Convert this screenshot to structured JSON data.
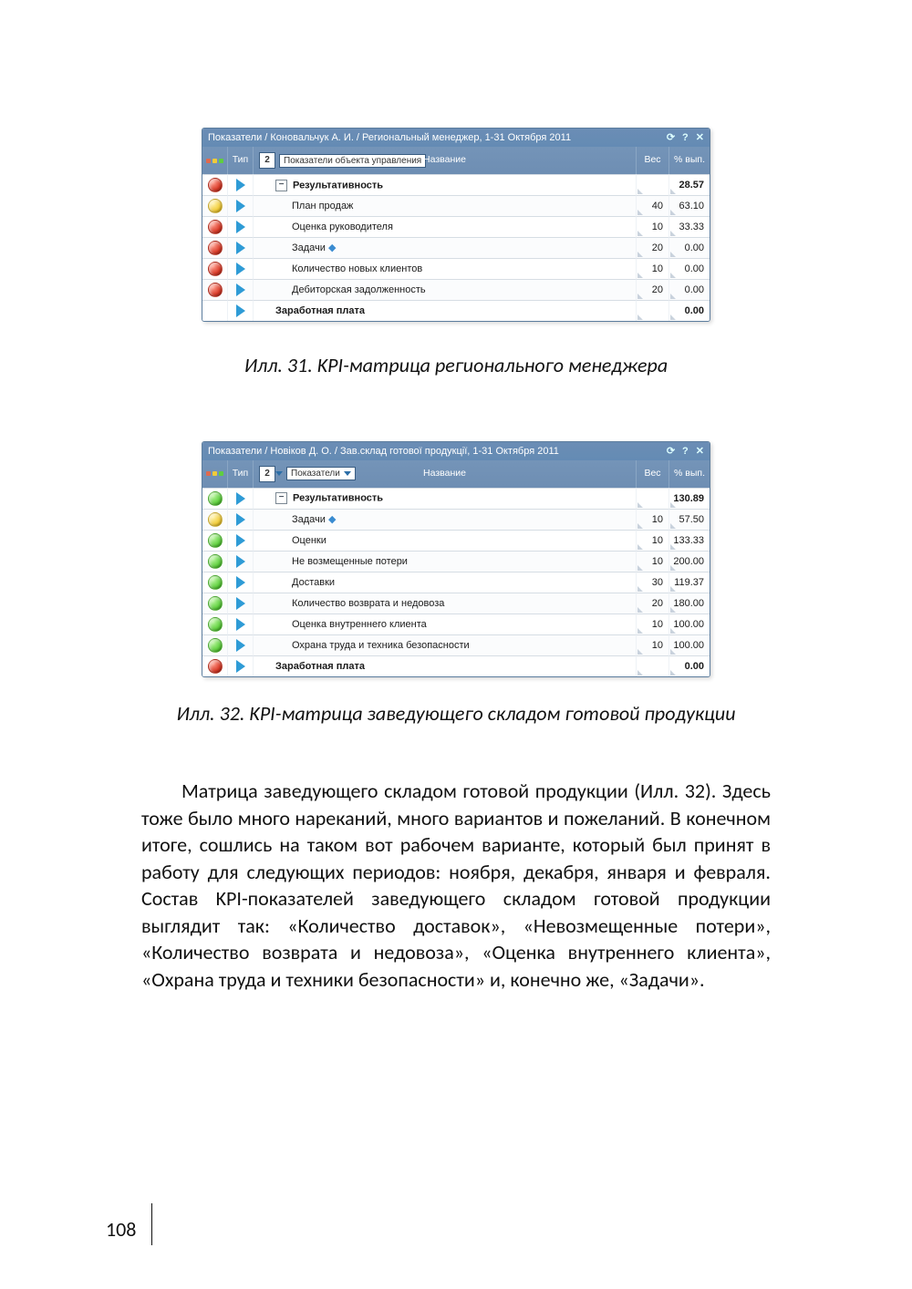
{
  "figure1": {
    "title": "Показатели / Коновальчук А. И. / Региональный менеджер, 1-31 Октября 2011",
    "toolbar_icons": {
      "refresh": "⟳",
      "help": "?",
      "close": "✕"
    },
    "columns": {
      "status": "",
      "type": "Тип",
      "name": "Название",
      "weight": "Вес",
      "pct": "% вып."
    },
    "level_value": "2",
    "dropdown_label": "Показатели объекта управления",
    "rows": [
      {
        "status": "red",
        "name": "Результативность",
        "weight": "",
        "pct": "28.57",
        "bold": true,
        "indent": 1,
        "expander": "minus"
      },
      {
        "status": "yellow",
        "name": "План продаж",
        "weight": "40",
        "pct": "63.10",
        "bold": false,
        "indent": 2
      },
      {
        "status": "red",
        "name": "Оценка руководителя",
        "weight": "10",
        "pct": "33.33",
        "bold": false,
        "indent": 2
      },
      {
        "status": "red",
        "name": "Задачи",
        "weight": "20",
        "pct": "0.00",
        "bold": false,
        "indent": 2,
        "flag": true
      },
      {
        "status": "red",
        "name": "Количество новых клиентов",
        "weight": "10",
        "pct": "0.00",
        "bold": false,
        "indent": 2
      },
      {
        "status": "red",
        "name": "Дебиторская задолженность",
        "weight": "20",
        "pct": "0.00",
        "bold": false,
        "indent": 2
      },
      {
        "status": "",
        "name": "Заработная плата",
        "weight": "",
        "pct": "0.00",
        "bold": true,
        "indent": 1
      }
    ]
  },
  "caption1": "Илл. 31. KPI-матрица регионального менеджера",
  "figure2": {
    "title": "Показатели / Новіков Д. О. / Зав.склад готової продукції, 1-31 Октября 2011",
    "toolbar_icons": {
      "refresh": "⟳",
      "help": "?",
      "close": "✕"
    },
    "columns": {
      "status": "",
      "type": "Тип",
      "name": "Название",
      "weight": "Вес",
      "pct": "% вып."
    },
    "level_value": "2",
    "dropdown_label": "Показатели",
    "rows": [
      {
        "status": "green",
        "name": "Результативность",
        "weight": "",
        "pct": "130.89",
        "bold": true,
        "indent": 1,
        "expander": "minus"
      },
      {
        "status": "yellow",
        "name": "Задачи",
        "weight": "10",
        "pct": "57.50",
        "bold": false,
        "indent": 2,
        "flag": true
      },
      {
        "status": "green",
        "name": "Оценки",
        "weight": "10",
        "pct": "133.33",
        "bold": false,
        "indent": 2
      },
      {
        "status": "green",
        "name": "Не возмещенные потери",
        "weight": "10",
        "pct": "200.00",
        "bold": false,
        "indent": 2
      },
      {
        "status": "green",
        "name": "Доставки",
        "weight": "30",
        "pct": "119.37",
        "bold": false,
        "indent": 2
      },
      {
        "status": "green",
        "name": "Количество возврата и недовоза",
        "weight": "20",
        "pct": "180.00",
        "bold": false,
        "indent": 2
      },
      {
        "status": "green",
        "name": "Оценка внутреннего клиента",
        "weight": "10",
        "pct": "100.00",
        "bold": false,
        "indent": 2
      },
      {
        "status": "green",
        "name": "Охрана труда и техника безопасности",
        "weight": "10",
        "pct": "100.00",
        "bold": false,
        "indent": 2
      },
      {
        "status": "red",
        "name": "Заработная плата",
        "weight": "",
        "pct": "0.00",
        "bold": true,
        "indent": 1
      }
    ]
  },
  "caption2": "Илл. 32. KPI-матрица заведующего складом готовой продукции",
  "body_text": "Матрица заведующего складом готовой продукции (Илл. 32). Здесь тоже было много нареканий, много вариантов и пожеланий. В конечном итоге, сошлись на таком вот рабочем варианте, который был принят в работу для следующих периодов: ноября, декабря, января и февраля. Состав KPI-показателей заведующего складом готовой продукции выглядит так: «Количество доставок», «Невозмещенные потери», «Количество возврата и недовоза», «Оценка внутреннего клиента», «Охрана труда и техники безопасности» и, конечно же, «Задачи».",
  "page_number": "108"
}
